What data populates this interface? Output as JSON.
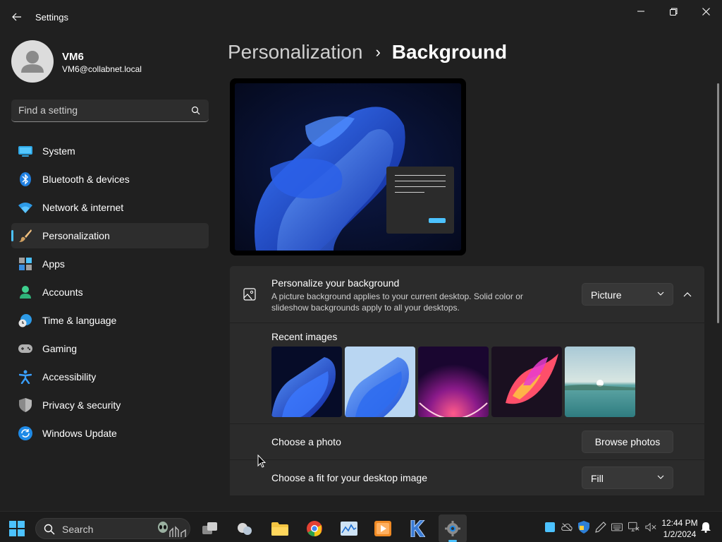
{
  "window": {
    "title": "Settings"
  },
  "profile": {
    "name": "VM6",
    "email": "VM6@collabnet.local"
  },
  "search": {
    "placeholder": "Find a setting"
  },
  "sidebar": {
    "items": [
      {
        "label": "System",
        "icon": "system-icon"
      },
      {
        "label": "Bluetooth & devices",
        "icon": "bluetooth-icon"
      },
      {
        "label": "Network & internet",
        "icon": "wifi-icon"
      },
      {
        "label": "Personalization",
        "icon": "brush-icon",
        "active": true
      },
      {
        "label": "Apps",
        "icon": "apps-icon"
      },
      {
        "label": "Accounts",
        "icon": "accounts-icon"
      },
      {
        "label": "Time & language",
        "icon": "time-language-icon"
      },
      {
        "label": "Gaming",
        "icon": "gamepad-icon"
      },
      {
        "label": "Accessibility",
        "icon": "accessibility-icon"
      },
      {
        "label": "Privacy & security",
        "icon": "shield-icon"
      },
      {
        "label": "Windows Update",
        "icon": "update-icon"
      }
    ]
  },
  "breadcrumb": {
    "parent": "Personalization",
    "separator": "›",
    "current": "Background"
  },
  "background_card": {
    "title": "Personalize your background",
    "description": "A picture background applies to your current desktop. Solid color or slideshow backgrounds apply to all your desktops.",
    "type_value": "Picture",
    "recent_label": "Recent images",
    "choose_photo_label": "Choose a photo",
    "browse_label": "Browse photos",
    "fit_label": "Choose a fit for your desktop image",
    "fit_value": "Fill"
  },
  "taskbar": {
    "search_label": "Search",
    "clock_time": "12:44 PM",
    "clock_date": "1/2/2024"
  },
  "colors": {
    "accent": "#4cc2ff",
    "background": "#202020",
    "card": "#2b2b2b"
  }
}
